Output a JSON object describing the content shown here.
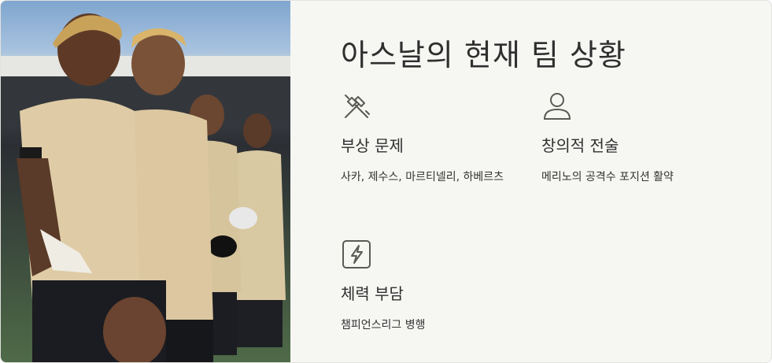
{
  "slide": {
    "title": "아스날의 현재 팀 상황",
    "photo_label": "team-players-photo",
    "features": [
      {
        "icon": "crossed-tools-icon",
        "title": "부상 문제",
        "description": "사카, 제수스, 마르티넬리, 하베르츠"
      },
      {
        "icon": "person-icon",
        "title": "창의적 전술",
        "description": "메리노의 공격수 포지션 활약"
      },
      {
        "icon": "lightning-box-icon",
        "title": "체력 부담",
        "description": "챔피언스리그 병행"
      }
    ]
  },
  "colors": {
    "accent_icon": "#5b5b55",
    "text": "#2f2f2f",
    "panel_bg": "#f6f6f3"
  }
}
